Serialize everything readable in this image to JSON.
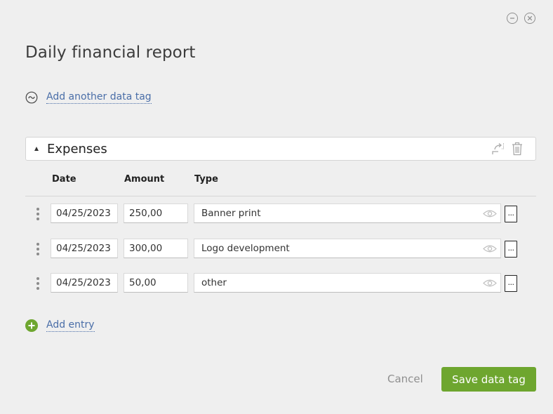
{
  "page": {
    "title": "Daily financial report"
  },
  "add_tag": {
    "label": "Add another data tag"
  },
  "section": {
    "title": "Expenses",
    "columns": {
      "date": "Date",
      "amount": "Amount",
      "type": "Type"
    },
    "rows": [
      {
        "date": "04/25/2023",
        "amount": "250,00",
        "type": "Banner print"
      },
      {
        "date": "04/25/2023",
        "amount": "300,00",
        "type": "Logo development"
      },
      {
        "date": "04/25/2023",
        "amount": "50,00",
        "type": "other"
      }
    ],
    "more_label": "..."
  },
  "add_entry": {
    "label": "Add entry"
  },
  "footer": {
    "cancel_label": "Cancel",
    "save_label": "Save data tag"
  },
  "colors": {
    "accent": "#6ea62f",
    "link": "#4a6ea8",
    "background": "#efefef"
  },
  "icons": [
    "minimize-icon",
    "close-icon",
    "tilde-icon",
    "caret-up-icon",
    "export-icon",
    "trash-icon",
    "drag-handle-icon",
    "eye-icon",
    "plus-icon"
  ]
}
